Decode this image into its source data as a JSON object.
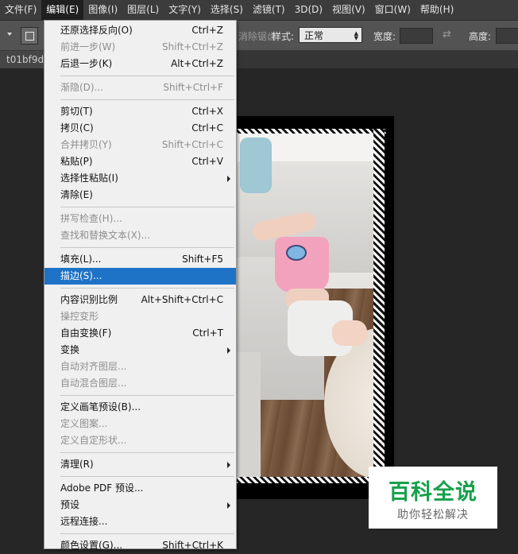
{
  "menubar": {
    "items": [
      "文件(F)",
      "编辑(E)",
      "图像(I)",
      "图层(L)",
      "文字(Y)",
      "选择(S)",
      "滤镜(T)",
      "3D(D)",
      "视图(V)",
      "窗口(W)",
      "帮助(H)"
    ]
  },
  "options": {
    "truncated_label": "消除锯齿",
    "style_label": "样式:",
    "style_value": "正常",
    "width_label": "宽度:",
    "height_label": "高度:"
  },
  "document": {
    "tab_name": "t01bf9d"
  },
  "edit_menu": {
    "items": [
      {
        "label": "还原选择反向(O)",
        "shortcut": "Ctrl+Z",
        "disabled": false
      },
      {
        "label": "前进一步(W)",
        "shortcut": "Shift+Ctrl+Z",
        "disabled": true
      },
      {
        "label": "后退一步(K)",
        "shortcut": "Alt+Ctrl+Z",
        "disabled": false
      },
      {
        "label": "渐隐(D)...",
        "shortcut": "Shift+Ctrl+F",
        "disabled": true
      },
      {
        "label": "剪切(T)",
        "shortcut": "Ctrl+X",
        "disabled": false
      },
      {
        "label": "拷贝(C)",
        "shortcut": "Ctrl+C",
        "disabled": false
      },
      {
        "label": "合并拷贝(Y)",
        "shortcut": "Shift+Ctrl+C",
        "disabled": true
      },
      {
        "label": "粘贴(P)",
        "shortcut": "Ctrl+V",
        "disabled": false
      },
      {
        "label": "选择性粘贴(I)",
        "shortcut": "",
        "disabled": false
      },
      {
        "label": "清除(E)",
        "shortcut": "",
        "disabled": false
      },
      {
        "label": "拼写检查(H)...",
        "shortcut": "",
        "disabled": true
      },
      {
        "label": "查找和替换文本(X)...",
        "shortcut": "",
        "disabled": true
      },
      {
        "label": "填充(L)...",
        "shortcut": "Shift+F5",
        "disabled": false
      },
      {
        "label": "描边(S)...",
        "shortcut": "",
        "disabled": false
      },
      {
        "label": "内容识别比例",
        "shortcut": "Alt+Shift+Ctrl+C",
        "disabled": false
      },
      {
        "label": "操控变形",
        "shortcut": "",
        "disabled": true
      },
      {
        "label": "自由变换(F)",
        "shortcut": "Ctrl+T",
        "disabled": false
      },
      {
        "label": "变换",
        "shortcut": "",
        "disabled": false
      },
      {
        "label": "自动对齐图层...",
        "shortcut": "",
        "disabled": true
      },
      {
        "label": "自动混合图层...",
        "shortcut": "",
        "disabled": true
      },
      {
        "label": "定义画笔预设(B)...",
        "shortcut": "",
        "disabled": false
      },
      {
        "label": "定义图案...",
        "shortcut": "",
        "disabled": true
      },
      {
        "label": "定义自定形状...",
        "shortcut": "",
        "disabled": true
      },
      {
        "label": "清理(R)",
        "shortcut": "",
        "disabled": false
      },
      {
        "label": "Adobe PDF 预设...",
        "shortcut": "",
        "disabled": false
      },
      {
        "label": "预设",
        "shortcut": "",
        "disabled": false
      },
      {
        "label": "远程连接...",
        "shortcut": "",
        "disabled": false
      },
      {
        "label": "颜色设置(G)...",
        "shortcut": "Shift+Ctrl+K",
        "disabled": false
      }
    ]
  },
  "watermark": {
    "title": "百科全说",
    "subtitle": "助你轻松解决"
  },
  "colors": {
    "highlight": "#1f73c7",
    "watermark_green": "#17a04a"
  }
}
